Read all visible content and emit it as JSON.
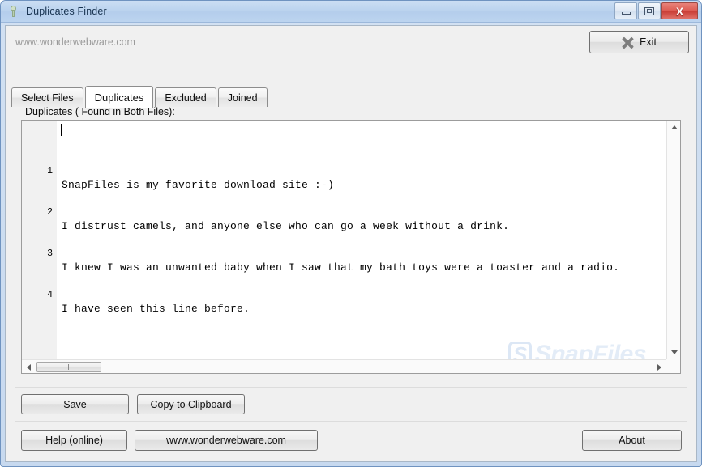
{
  "window": {
    "title": "Duplicates Finder",
    "icon": "pin-icon",
    "controls": {
      "minimize": "minimize-icon",
      "maximize": "maximize-icon",
      "close": "X"
    }
  },
  "header": {
    "site_label": "www.wonderwebware.com",
    "exit_label": "Exit",
    "exit_icon": "x-mark-icon"
  },
  "tabs": [
    {
      "label": "Select Files",
      "active": false
    },
    {
      "label": "Duplicates",
      "active": true
    },
    {
      "label": "Excluded",
      "active": false
    },
    {
      "label": "Joined",
      "active": false
    }
  ],
  "groupbox": {
    "legend": "Duplicates ( Found in Both Files):"
  },
  "editor": {
    "watermark": "SnapFiles",
    "watermark_badge": "S",
    "lines": [
      {
        "number": "1",
        "text": "SnapFiles is my favorite download site :-)"
      },
      {
        "number": "2",
        "text": "I distrust camels, and anyone else who can go a week without a drink."
      },
      {
        "number": "3",
        "text": "I knew I was an unwanted baby when I saw that my bath toys were a toaster and a radio."
      },
      {
        "number": "4",
        "text": "I have seen this line before."
      }
    ]
  },
  "buttons": {
    "save": "Save",
    "copy_to_clipboard": "Copy to Clipboard",
    "help_online": "Help (online)",
    "website": "www.wonderwebware.com",
    "about": "About"
  },
  "colors": {
    "titlebar": "#b4cdec",
    "close_button": "#c93c35",
    "client_bg": "#f0f0f0",
    "editor_bg": "#ffffff",
    "watermark": "#e3ecf7"
  }
}
